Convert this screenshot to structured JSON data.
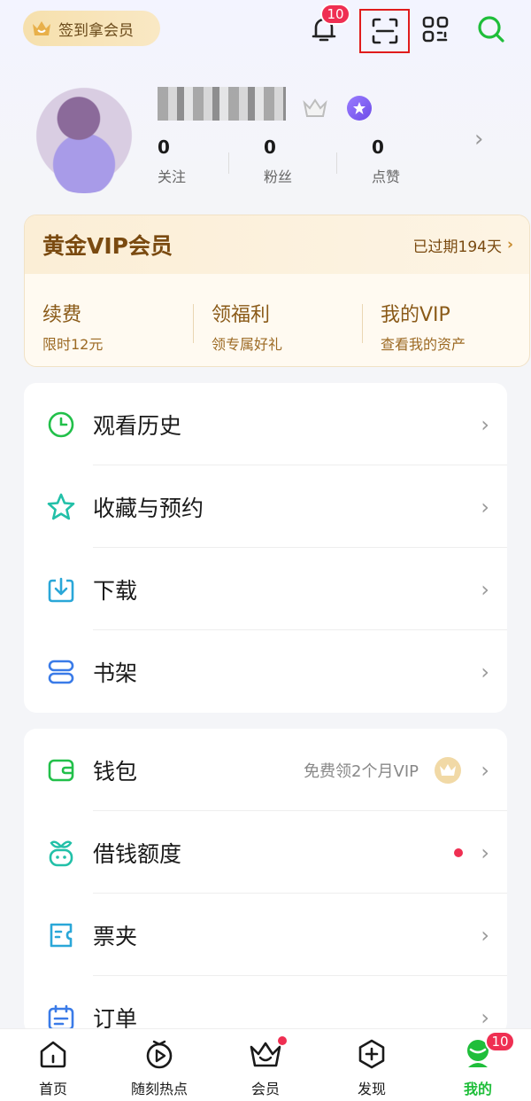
{
  "topbar": {
    "signin_label": "签到拿会员",
    "notification_badge": "10"
  },
  "profile": {
    "stats": [
      {
        "value": "0",
        "label": "关注"
      },
      {
        "value": "0",
        "label": "粉丝"
      },
      {
        "value": "0",
        "label": "点赞"
      }
    ]
  },
  "vip": {
    "title": "黄金VIP会员",
    "expired": "已过期194天",
    "items": [
      {
        "title": "续费",
        "subtitle": "限时12元"
      },
      {
        "title": "领福利",
        "subtitle": "领专属好礼"
      },
      {
        "title": "我的VIP",
        "subtitle": "查看我的资产"
      }
    ]
  },
  "menu1": [
    {
      "label": "观看历史",
      "icon": "clock-icon"
    },
    {
      "label": "收藏与预约",
      "icon": "star-icon"
    },
    {
      "label": "下载",
      "icon": "download-icon"
    },
    {
      "label": "书架",
      "icon": "bookshelf-icon"
    }
  ],
  "menu2": [
    {
      "label": "钱包",
      "icon": "wallet-icon",
      "extra": "免费领2个月VIP"
    },
    {
      "label": "借钱额度",
      "icon": "sprout-icon"
    },
    {
      "label": "票夹",
      "icon": "ticket-icon"
    },
    {
      "label": "订单",
      "icon": "calendar-icon"
    }
  ],
  "tabbar": {
    "tabs": [
      {
        "label": "首页"
      },
      {
        "label": "随刻热点"
      },
      {
        "label": "会员"
      },
      {
        "label": "发现"
      },
      {
        "label": "我的"
      }
    ],
    "mine_badge": "10"
  },
  "colors": {
    "accent": "#1fbe3a",
    "badge": "#ef2f52",
    "vip_text": "#7a4a10"
  }
}
